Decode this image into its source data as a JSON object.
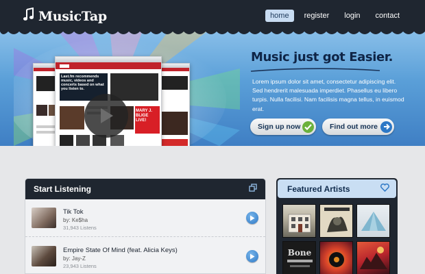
{
  "header": {
    "logo_text": "MusicTap",
    "nav": [
      {
        "label": "home",
        "active": true
      },
      {
        "label": "register",
        "active": false
      },
      {
        "label": "login",
        "active": false
      },
      {
        "label": "contact",
        "active": false
      }
    ]
  },
  "hero": {
    "title": "Music just got Easier.",
    "text": "Lorem ipsum dolor sit amet, consectetur adipiscing elit. Sed hendrerit malesuada imperdiet. Phasellus eu libero turpis. Nulla facilisi. Nam facilisis magna tellus, in euismod erat.",
    "signup_label": "Sign up now",
    "find_label": "Find out more",
    "screenshot_text_1": "Last.fm recommends music, videos and concerts based on what you listen to.",
    "screenshot_text_2": "MARY J. BLIGE LIVE!"
  },
  "listening": {
    "title": "Start Listening",
    "tracks": [
      {
        "name": "Tik Tok",
        "artist": "by: Ke$ha",
        "listens": "31,943 Listens"
      },
      {
        "name": "Empire State Of Mind (feat. Alicia Keys)",
        "artist": "by: Jay-Z",
        "listens": "23,943 Listens"
      }
    ]
  },
  "featured": {
    "title": "Featured Artists"
  },
  "colors": {
    "dark": "#1f2630",
    "hero_blue": "#5a9fd8",
    "accent_green": "#6bb13c",
    "accent_blue": "#2d78c6"
  },
  "icons": {
    "logo": "music-note-icon",
    "signup": "check-circle-icon",
    "find": "arrow-right-circle-icon",
    "panel": "popout-icon",
    "featured": "heart-icon",
    "track": "play-icon"
  }
}
